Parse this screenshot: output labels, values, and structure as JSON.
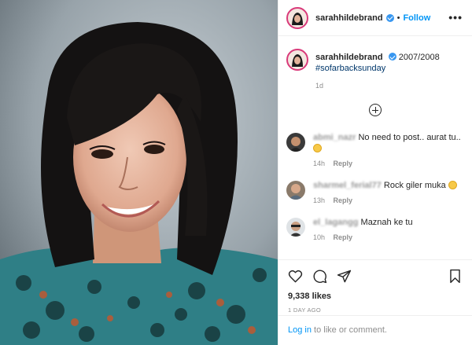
{
  "post": {
    "username": "sarahhildebrand",
    "follow_label": "Follow",
    "more_label": "•••",
    "separator": "•"
  },
  "caption": {
    "username": "sarahhildebrand",
    "text": "2007/2008",
    "hashtag": "#sofarbacksunday",
    "time": "1d"
  },
  "comments": [
    {
      "username": "abmi_nazr",
      "text": "No need to post.. aurat tu..",
      "time": "14h",
      "reply_label": "Reply",
      "emoji": "smiling-face"
    },
    {
      "username": "sharmel_ferial77",
      "text": "Rock giler muka",
      "time": "13h",
      "reply_label": "Reply",
      "emoji": "laughing-face"
    },
    {
      "username": "el_lagangg",
      "text": "Maznah ke tu",
      "time": "10h",
      "reply_label": "Reply"
    }
  ],
  "actions": {
    "likes": "9,338 likes",
    "posted_ago": "1 DAY AGO",
    "icons": [
      "heart-icon",
      "comment-icon",
      "share-icon",
      "bookmark-icon"
    ]
  },
  "login": {
    "link_text": "Log in",
    "rest_text": " to like or comment."
  },
  "colors": {
    "accent": "#0095f6",
    "verified": "#3897f0",
    "story_ring": "#d93a7a",
    "muted": "#8e8e8e"
  }
}
